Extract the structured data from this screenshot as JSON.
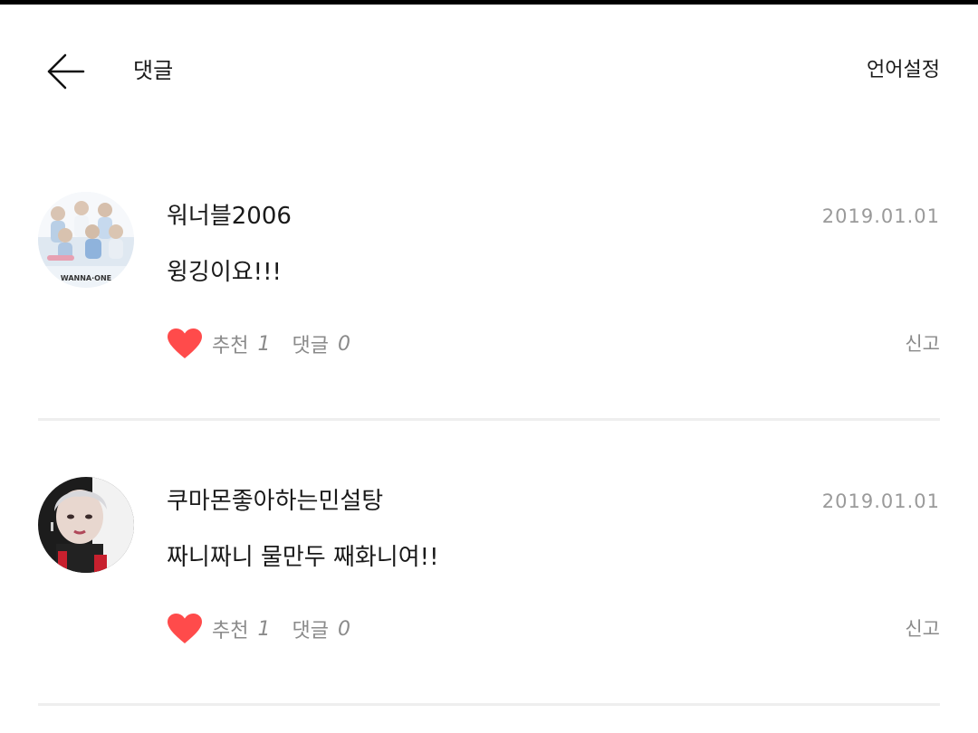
{
  "header": {
    "title": "댓글",
    "language_label": "언어설정"
  },
  "comments": [
    {
      "username": "워너블2006",
      "date": "2019.01.01",
      "text": "윙깅이요!!!",
      "like_label": "추천",
      "like_count": "1",
      "reply_label": "댓글",
      "reply_count": "0",
      "report_label": "신고",
      "avatar_caption": "WANNA·ONE"
    },
    {
      "username": "쿠마몬좋아하는민설탕",
      "date": "2019.01.01",
      "text": "짜니짜니 물만두 째화니여!!",
      "like_label": "추천",
      "like_count": "1",
      "reply_label": "댓글",
      "reply_count": "0",
      "report_label": "신고"
    }
  ],
  "colors": {
    "heart": "#ff4b4b",
    "muted_text": "#8a8a8a",
    "date_text": "#9a9a9a",
    "divider": "#eeeeee"
  },
  "icons": {
    "back": "arrow-left-icon",
    "like": "heart-icon"
  }
}
